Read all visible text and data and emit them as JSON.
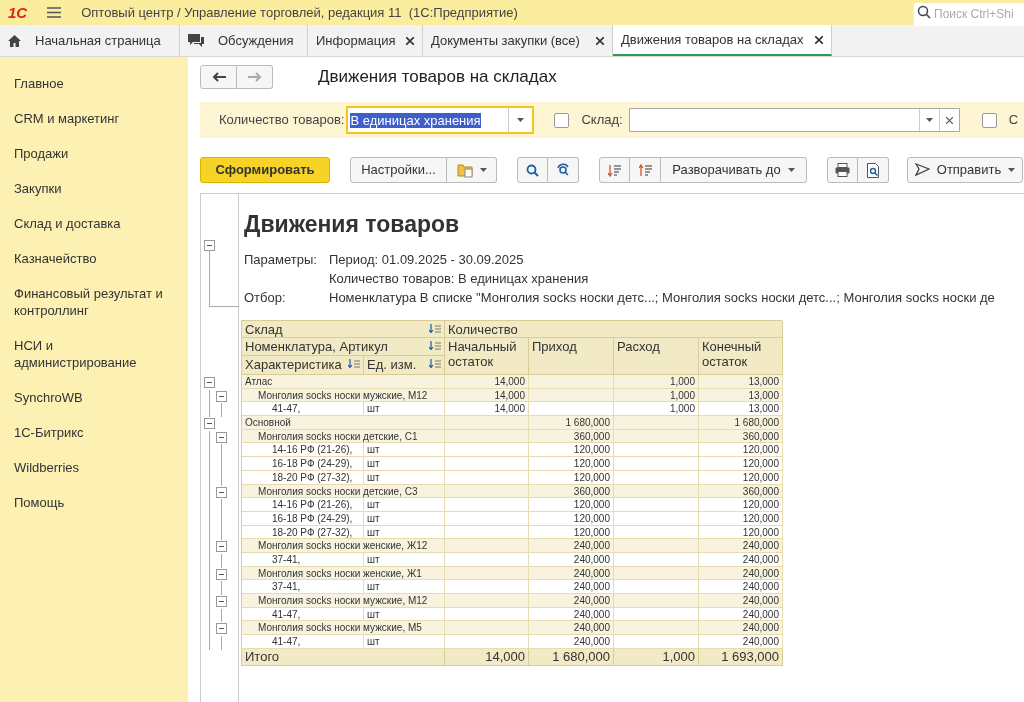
{
  "app_bar": {
    "logo": "1С",
    "title": "Оптовый центр / Управление торговлей, редакция 11  (1С:Предприятие)",
    "search_placeholder": "Поиск Ctrl+Shi"
  },
  "tabs": [
    {
      "label": "Начальная страница",
      "kind": "home",
      "closable": false,
      "selected": false
    },
    {
      "label": "Обсуждения",
      "kind": "chat",
      "closable": false,
      "selected": false
    },
    {
      "label": "Информация",
      "kind": "plain",
      "closable": true,
      "selected": false
    },
    {
      "label": "Документы закупки (все)",
      "kind": "plain",
      "closable": true,
      "selected": false
    },
    {
      "label": "Движения товаров на складах",
      "kind": "plain",
      "closable": true,
      "selected": true
    }
  ],
  "sidebar": {
    "items": [
      "Главное",
      "CRM и маркетинг",
      "Продажи",
      "Закупки",
      "Склад и доставка",
      "Казначейство",
      "Финансовый результат и контроллинг",
      "НСИ и администрирование",
      "SynchroWB",
      "1С-Битрикс",
      "Wildberries",
      "Помощь"
    ]
  },
  "page_title": "Движения товаров на складах",
  "filters": [
    {
      "kind": "select",
      "label": "Количество товаров:",
      "value": "В единицах хранения",
      "focused": true,
      "text_selected": true
    },
    {
      "kind": "checkbox_select",
      "label": "Склад:",
      "checked": false
    },
    {
      "kind": "checkbox",
      "label": "С",
      "checked": false
    }
  ],
  "toolbar": {
    "generate": "Сформировать",
    "settings": "Настройки...",
    "expand": "Разворачивать до",
    "send": "Отправить"
  },
  "report": {
    "title": "Движения товаров",
    "params": [
      {
        "label": "Параметры:",
        "lines": [
          "Период: 01.09.2025 - 30.09.2025",
          "Количество товаров: В единицах хранения"
        ]
      },
      {
        "label": "Отбор:",
        "lines": [
          "Номенклатура В списке \"Монголия socks носки детс...; Монголия socks носки детс...; Монголия socks носки де"
        ]
      }
    ],
    "header": {
      "warehouse": "Склад",
      "quantity": "Количество",
      "item": "Номенклатура, Артикул",
      "characteristic": "Характеристика",
      "unit": "Ед. изм.",
      "opening": "Начальный остаток",
      "receipt": "Приход",
      "expense": "Расход",
      "closing": "Конечный остаток"
    },
    "rows": [
      {
        "name": "Атлас",
        "opening": "14,000",
        "expense": "1,000",
        "closing": "13,000",
        "children": [
          {
            "name": "Монголия socks носки мужские, М12",
            "opening": "14,000",
            "expense": "1,000",
            "closing": "13,000",
            "children": [
              {
                "name": "41-47,",
                "unit": "шт",
                "opening": "14,000",
                "expense": "1,000",
                "closing": "13,000"
              }
            ]
          }
        ]
      },
      {
        "name": "Основной",
        "receipt": "1 680,000",
        "closing": "1 680,000",
        "children": [
          {
            "name": "Монголия socks носки детские, С1",
            "receipt": "360,000",
            "closing": "360,000",
            "children": [
              {
                "name": "14-16 РФ (21-26),",
                "unit": "шт",
                "receipt": "120,000",
                "closing": "120,000"
              },
              {
                "name": "16-18 РФ (24-29),",
                "unit": "шт",
                "receipt": "120,000",
                "closing": "120,000"
              },
              {
                "name": "18-20 РФ (27-32),",
                "unit": "шт",
                "receipt": "120,000",
                "closing": "120,000"
              }
            ]
          },
          {
            "name": "Монголия socks носки детские, С3",
            "receipt": "360,000",
            "closing": "360,000",
            "children": [
              {
                "name": "14-16 РФ (21-26),",
                "unit": "шт",
                "receipt": "120,000",
                "closing": "120,000"
              },
              {
                "name": "16-18 РФ (24-29),",
                "unit": "шт",
                "receipt": "120,000",
                "closing": "120,000"
              },
              {
                "name": "18-20 РФ (27-32),",
                "unit": "шт",
                "receipt": "120,000",
                "closing": "120,000"
              }
            ]
          },
          {
            "name": "Монголия socks носки женские, Ж12",
            "receipt": "240,000",
            "closing": "240,000",
            "children": [
              {
                "name": "37-41,",
                "unit": "шт",
                "receipt": "240,000",
                "closing": "240,000"
              }
            ]
          },
          {
            "name": "Монголия socks носки женские, Ж1",
            "receipt": "240,000",
            "closing": "240,000",
            "children": [
              {
                "name": "37-41,",
                "unit": "шт",
                "receipt": "240,000",
                "closing": "240,000"
              }
            ]
          },
          {
            "name": "Монголия socks носки мужские, М12",
            "receipt": "240,000",
            "closing": "240,000",
            "children": [
              {
                "name": "41-47,",
                "unit": "шт",
                "receipt": "240,000",
                "closing": "240,000"
              }
            ]
          },
          {
            "name": "Монголия socks носки мужские, М5",
            "receipt": "240,000",
            "closing": "240,000",
            "children": [
              {
                "name": "41-47,",
                "unit": "шт",
                "receipt": "240,000",
                "closing": "240,000"
              }
            ]
          }
        ]
      }
    ],
    "total": {
      "label": "Итого",
      "opening": "14,000",
      "receipt": "1 680,000",
      "expense": "1,000",
      "closing": "1 693,000"
    }
  }
}
